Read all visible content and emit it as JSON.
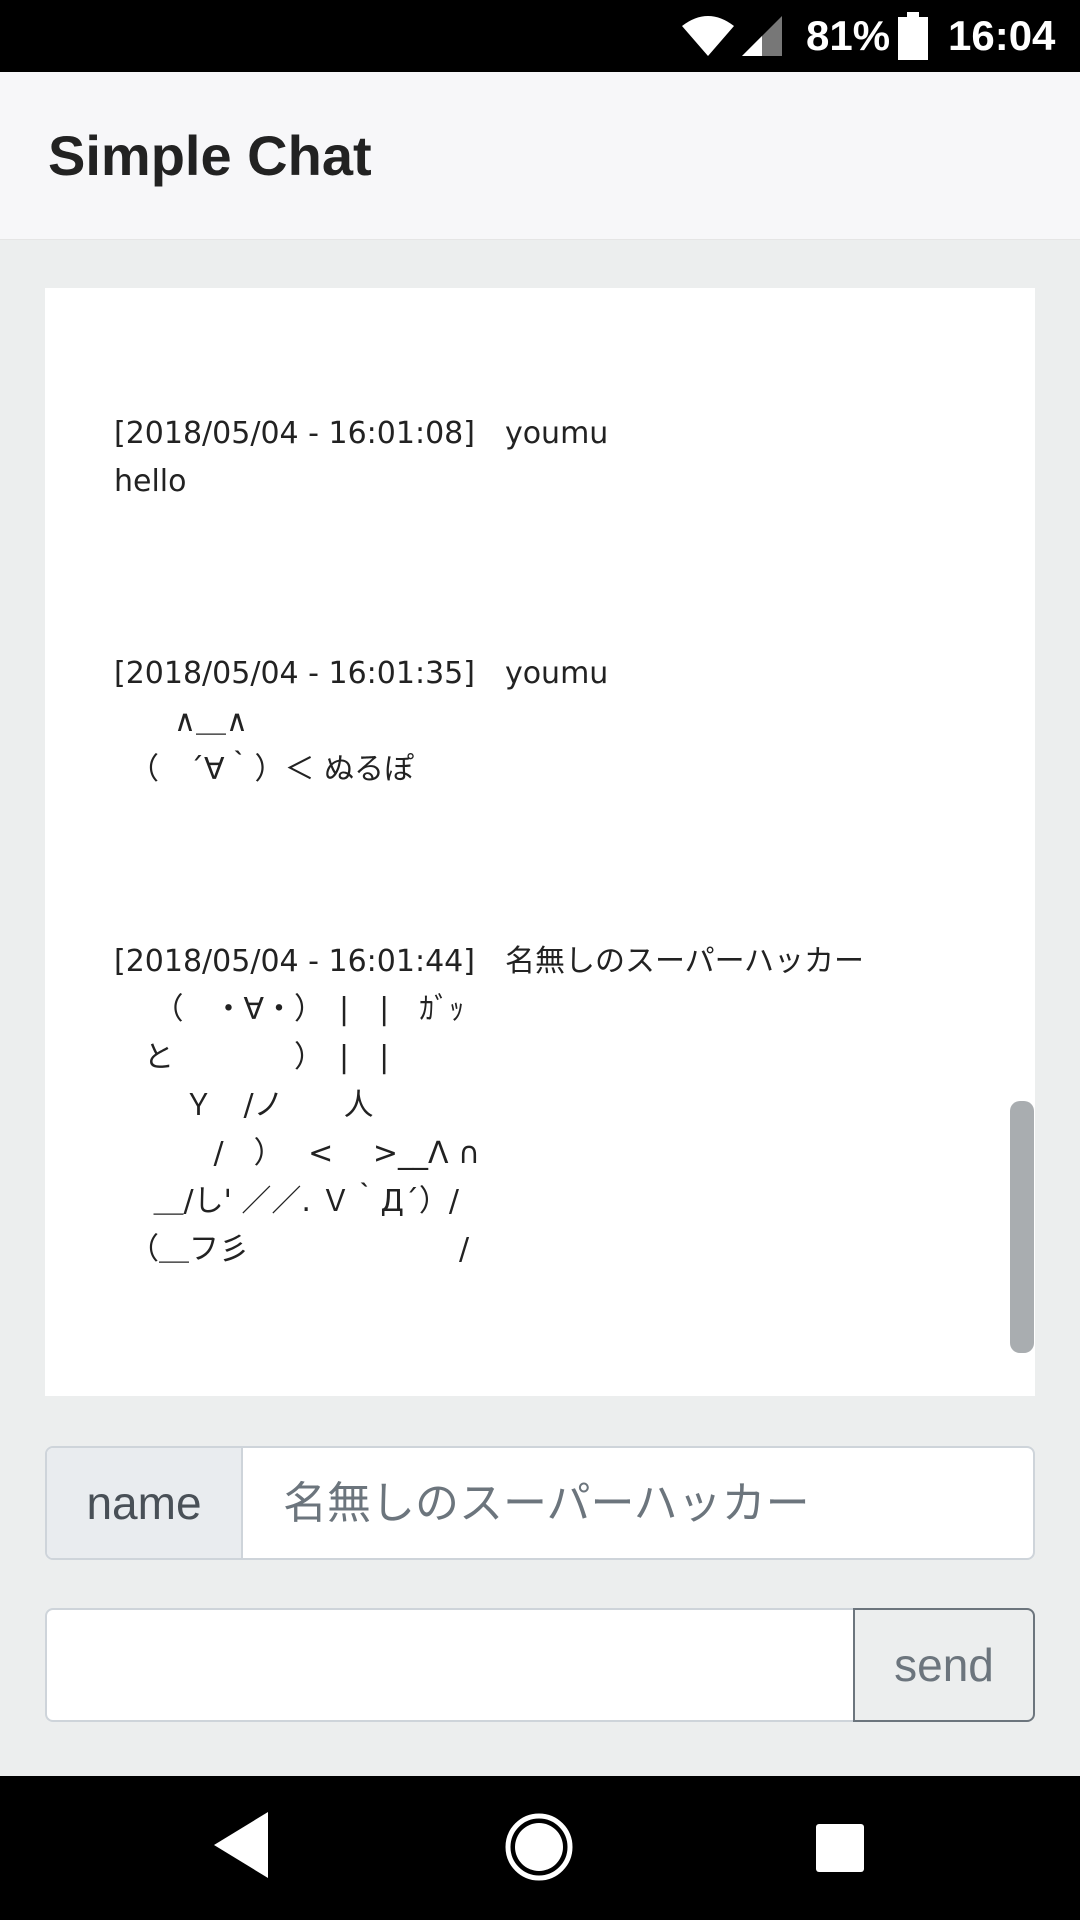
{
  "status_bar": {
    "battery_percent": "81%",
    "time": "16:04",
    "icons": [
      "wifi-icon",
      "cell-signal-icon",
      "battery-icon"
    ]
  },
  "header": {
    "title": "Simple Chat"
  },
  "messages": [
    {
      "meta": "[2018/05/04 - 16:01:08]　youmu",
      "body": "hello"
    },
    {
      "meta": "[2018/05/04 - 16:01:35]　youmu",
      "body": "　　∧＿∧\n　（　´∀｀）＜ ぬるぽ"
    },
    {
      "meta": "[2018/05/04 - 16:01:44]　名無しのスーパーハッカー",
      "body": "　 （　・∀・）　|　|　ｶﾞｯ\n　と　　　　）　|　|\n　　 Ｙ　/ノ　　人\n　　　 /　）　 <　 >__Λ ∩\n　 ＿/し' ／／. Ｖ｀Д´）/\n　（＿フ彡　　　　　　　/"
    }
  ],
  "form": {
    "name_label": "name",
    "name_placeholder": "名無しのスーパーハッカー",
    "message_value": "",
    "send_label": "send"
  },
  "nav_bar": {
    "icons": [
      "back-icon",
      "home-icon",
      "recent-apps-icon"
    ]
  }
}
